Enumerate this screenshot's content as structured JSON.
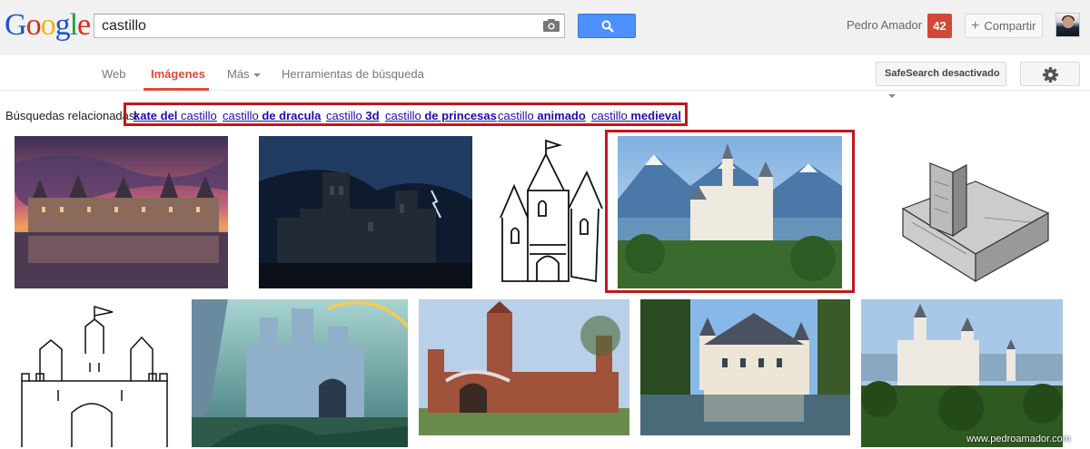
{
  "logo": {
    "letters": [
      "G",
      "o",
      "o",
      "g",
      "l",
      "e"
    ],
    "colors": [
      "#1a53d6",
      "#d62d20",
      "#f2b400",
      "#1a53d6",
      "#1e9e3e",
      "#d62d20"
    ]
  },
  "search": {
    "query": "castillo",
    "camera_icon": "camera-icon",
    "button_icon": "search-icon"
  },
  "user": {
    "name": "Pedro Amador",
    "notifications": "42",
    "share_label": "Compartir"
  },
  "nav": {
    "tabs": [
      {
        "label": "Web",
        "active": false
      },
      {
        "label": "Imágenes",
        "active": true
      },
      {
        "label": "Más",
        "active": false,
        "dropdown": true
      },
      {
        "label": "Herramientas de búsqueda",
        "active": false
      }
    ],
    "safesearch_label": "SafeSearch desactivado",
    "settings_icon": "gear-icon"
  },
  "related": {
    "label": "Búsquedas relacionadas:",
    "links": [
      {
        "plain": "",
        "bold": "kate del",
        "suffix": " castillo"
      },
      {
        "plain": "castillo ",
        "bold": "de dracula",
        "suffix": ""
      },
      {
        "plain": "castillo ",
        "bold": "3d",
        "suffix": ""
      },
      {
        "plain": "castillo ",
        "bold": "de princesas",
        "suffix": ""
      },
      {
        "plain": "castillo ",
        "bold": "animado",
        "suffix": ""
      },
      {
        "plain": "castillo ",
        "bold": "medieval",
        "suffix": ""
      }
    ]
  },
  "images": [
    {
      "name": "castle-sunset-reflection"
    },
    {
      "name": "dark-castle-storm"
    },
    {
      "name": "castle-cartoon-drawing"
    },
    {
      "name": "neuschwanstein-mountains"
    },
    {
      "name": "castle-pencil-sketch"
    },
    {
      "name": "castle-line-drawing"
    },
    {
      "name": "fantasy-castle-painting"
    },
    {
      "name": "red-brick-castle"
    },
    {
      "name": "castle-on-lake"
    },
    {
      "name": "neuschwanstein-forest"
    }
  ],
  "watermark": "www.pedroamador.com",
  "colors": {
    "accent": "#dd4b39",
    "highlight": "#c4161c",
    "link": "#1a0dab",
    "search_button": "#4d90fe"
  }
}
